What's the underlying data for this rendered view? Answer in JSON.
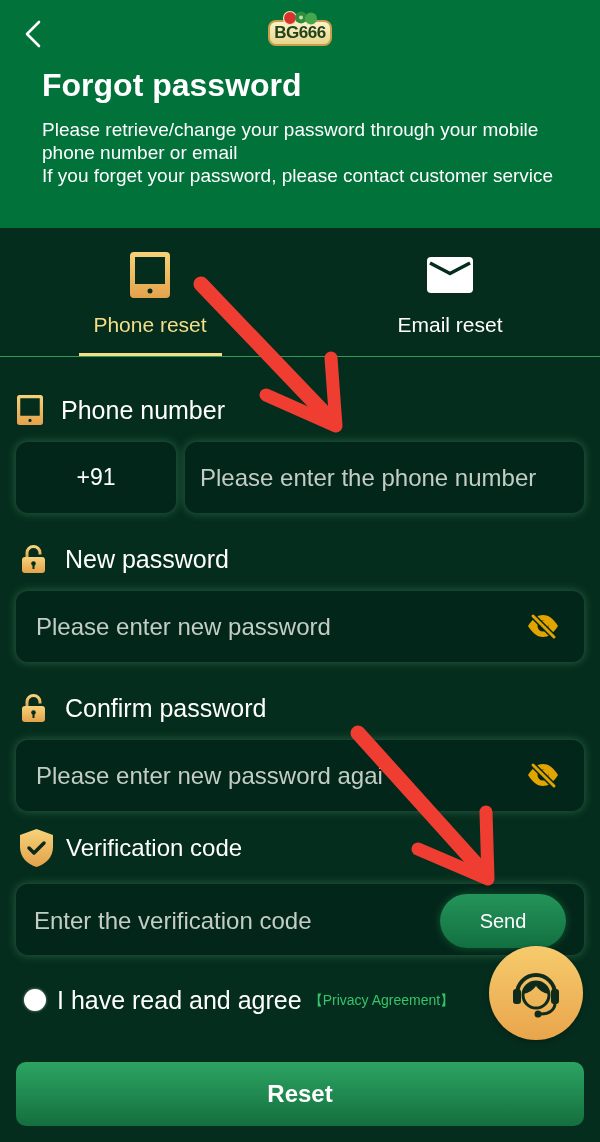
{
  "header": {
    "logo_text": "BG666",
    "title": "Forgot password",
    "description": [
      "Please retrieve/change your password through your mobile phone number or email",
      "If you forget your password, please contact customer service"
    ]
  },
  "tabs": [
    {
      "kind": "phone",
      "label": "Phone reset",
      "selected": true
    },
    {
      "kind": "email",
      "label": "Email reset",
      "selected": false
    }
  ],
  "form": {
    "fields": [
      {
        "kind": "phone",
        "label": "Phone number",
        "country_code": "+91",
        "placeholder": "Please enter the phone number"
      },
      {
        "kind": "password",
        "label": "New password",
        "placeholder": "Please enter new password"
      },
      {
        "kind": "password",
        "label": "Confirm password",
        "placeholder": "Please enter new password agai"
      },
      {
        "kind": "code",
        "label": "Verification code",
        "placeholder": "Enter the verification code",
        "button": "Send"
      }
    ]
  },
  "agreement": {
    "checked": false,
    "text": "I have read and agree",
    "link": "【Privacy Agreement】"
  },
  "submit_button": "Reset"
}
